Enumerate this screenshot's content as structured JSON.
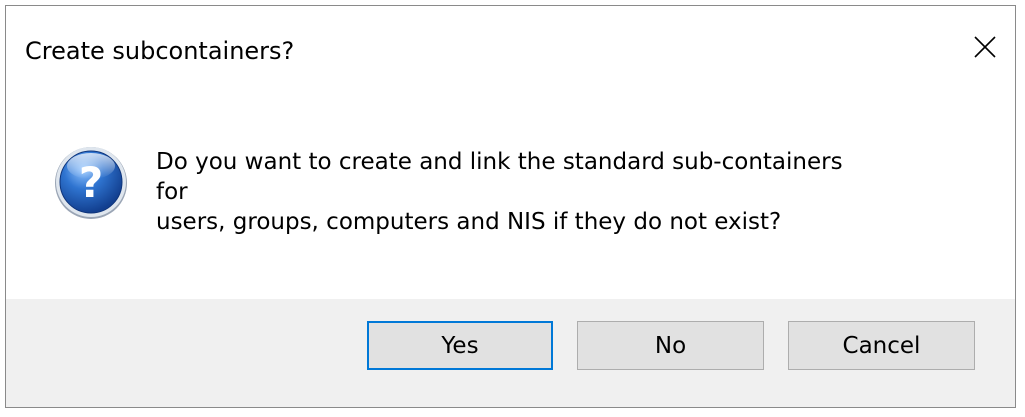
{
  "dialog": {
    "title": "Create subcontainers?",
    "icon": "question-icon",
    "message_lines": [
      "Do you want to create and link the standard sub-containers",
      "for",
      "users, groups, computers and NIS if they do not exist?"
    ],
    "buttons": {
      "yes": "Yes",
      "no": "No",
      "cancel": "Cancel"
    },
    "colors": {
      "button_bar": "#f0f0f0",
      "button_face": "#e1e1e1",
      "icon_blue": "#1f5fbf",
      "default_border": "#0078d7"
    }
  }
}
